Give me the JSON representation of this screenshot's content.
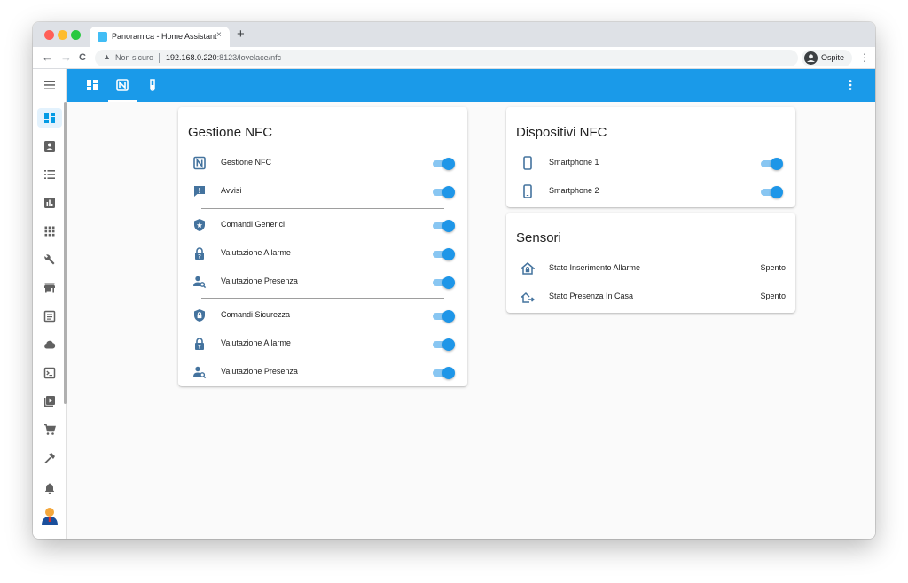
{
  "browser": {
    "tab_title": "Panoramica - Home Assistant",
    "tab_close": "×",
    "new_tab": "+",
    "nav_back": "←",
    "nav_forward": "→",
    "nav_reload": "C",
    "security_icon": "warning-triangle-icon",
    "security_label": "Non sicuro",
    "url_host": "192.168.0.220",
    "url_path": ":8123/lovelace/nfc",
    "profile_label": "Ospite",
    "menu_icon": "⋮",
    "traffic_colors": [
      "#ff5f57",
      "#febc2e",
      "#28c840"
    ]
  },
  "app": {
    "header_color": "#1a9ae9",
    "accent_color": "#1e96e8",
    "view_tabs": [
      {
        "icon": "dashboard-icon"
      },
      {
        "icon": "nfc-icon",
        "active": true
      },
      {
        "icon": "tube-icon"
      }
    ],
    "sidebar_icons": [
      "dashboard-icon",
      "account-box-icon",
      "list-icon",
      "chart-icon",
      "apps-icon",
      "wrench-icon",
      "store-icon",
      "document-icon",
      "cloud-icon",
      "console-icon",
      "play-box-icon",
      "cart-icon",
      "hammer-icon",
      "bell-icon",
      "user-avatar-icon"
    ]
  },
  "cards": {
    "gestione": {
      "title": "Gestione NFC",
      "rows": [
        {
          "label": "Gestione NFC",
          "icon": "nfc-icon",
          "on": true
        },
        {
          "label": "Avvisi",
          "icon": "message-alert-icon",
          "on": true
        },
        {
          "label": "Comandi Generici",
          "icon": "shield-star-icon",
          "on": true
        },
        {
          "label": "Valutazione Allarme",
          "icon": "lock-question-icon",
          "on": true
        },
        {
          "label": "Valutazione Presenza",
          "icon": "account-search-icon",
          "on": true
        },
        {
          "label": "Comandi Sicurezza",
          "icon": "shield-lock-icon",
          "on": true
        },
        {
          "label": "Valutazione Allarme",
          "icon": "lock-question-icon",
          "on": true
        },
        {
          "label": "Valutazione Presenza",
          "icon": "account-search-icon",
          "on": true
        }
      ]
    },
    "dispositivi": {
      "title": "Dispositivi NFC",
      "rows": [
        {
          "label": "Smartphone 1",
          "icon": "cellphone-icon",
          "on": true
        },
        {
          "label": "Smartphone 2",
          "icon": "cellphone-icon",
          "on": true
        }
      ]
    },
    "sensori": {
      "title": "Sensori",
      "rows": [
        {
          "label": "Stato Inserimento Allarme",
          "icon": "home-lock-icon",
          "state": "Spento"
        },
        {
          "label": "Stato Presenza In Casa",
          "icon": "home-export-icon",
          "state": "Spento"
        }
      ]
    }
  }
}
